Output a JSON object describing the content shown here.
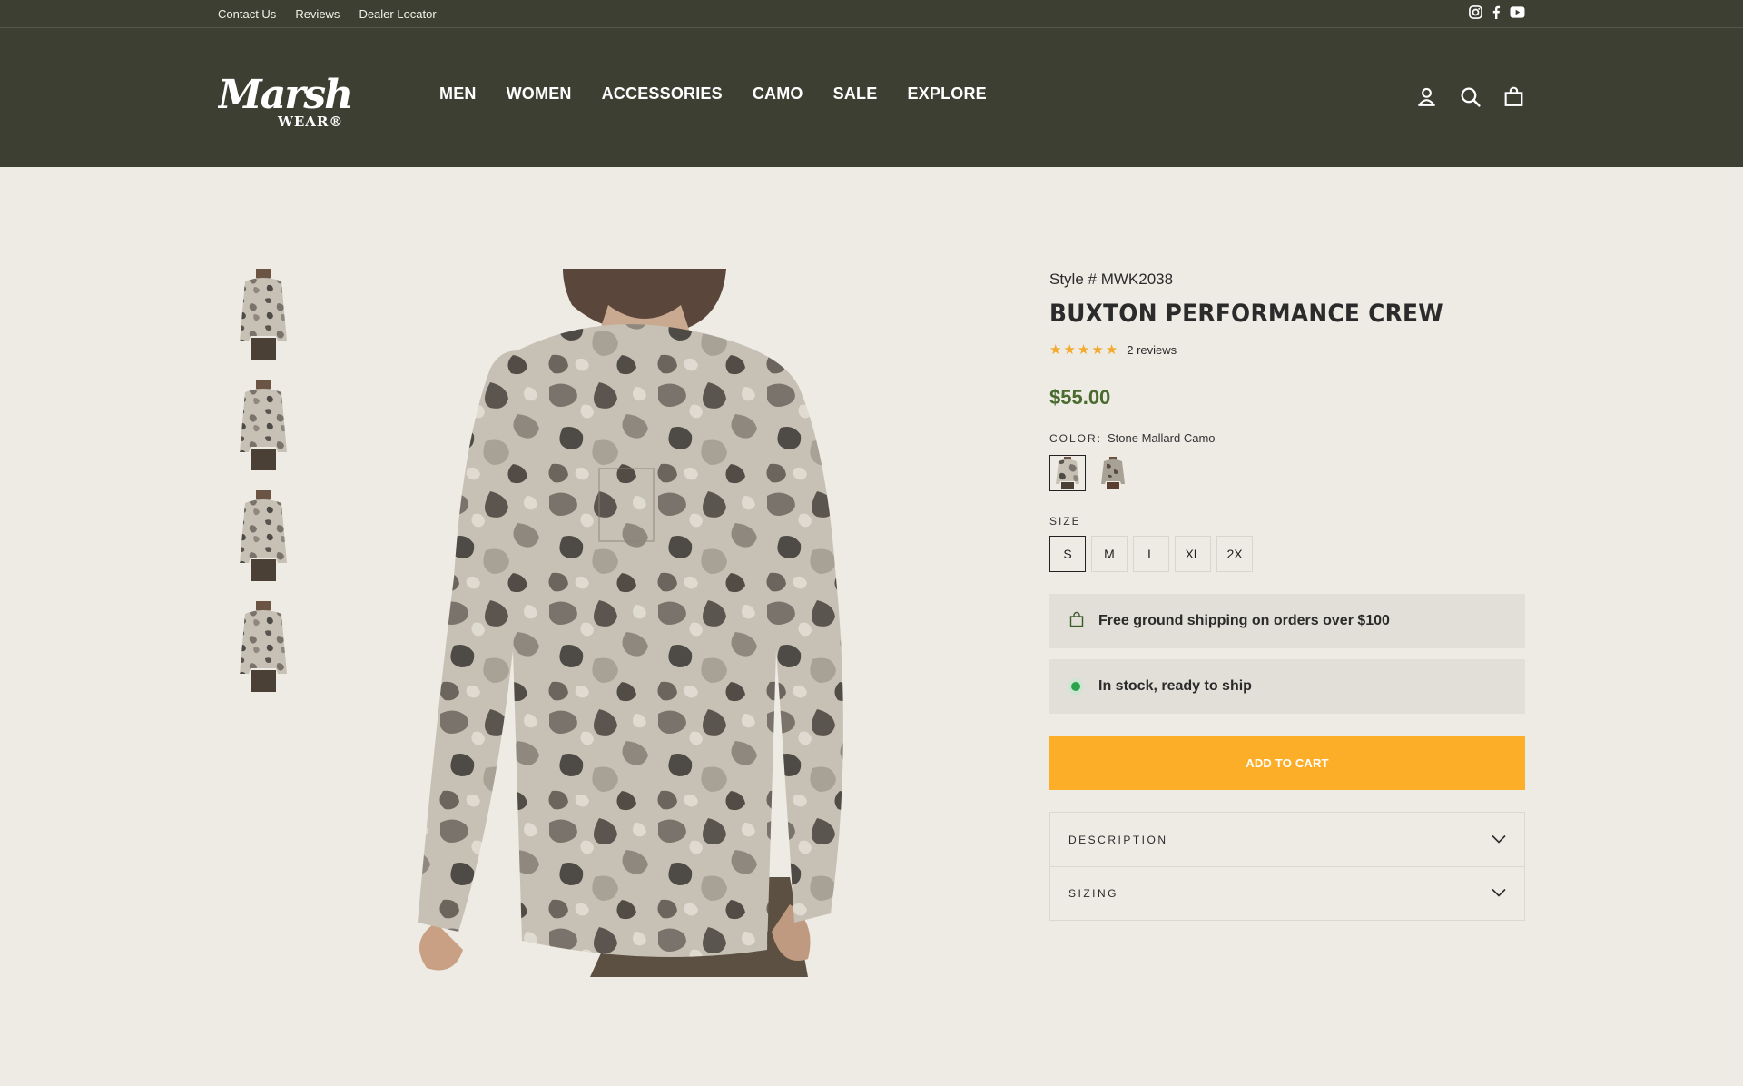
{
  "utility": {
    "links": [
      "Contact Us",
      "Reviews",
      "Dealer Locator"
    ],
    "social_icons": [
      "instagram-icon",
      "facebook-icon",
      "youtube-icon"
    ]
  },
  "header": {
    "logo_text": "Marsh WEAR",
    "nav": [
      "MEN",
      "WOMEN",
      "ACCESSORIES",
      "CAMO",
      "SALE",
      "EXPLORE"
    ],
    "icons": [
      "account-icon",
      "search-icon",
      "cart-icon"
    ]
  },
  "gallery": {
    "thumbnail_count": 4
  },
  "product": {
    "style_number": "Style # MWK2038",
    "title": "BUXTON PERFORMANCE CREW",
    "rating": 5,
    "reviews": "2 reviews",
    "price": "$55.00",
    "color_label": "COLOR:",
    "color_value": "Stone Mallard Camo",
    "size_label": "SIZE",
    "sizes": [
      "S",
      "M",
      "L",
      "XL",
      "2X"
    ],
    "selected_size": "S",
    "shipping_notice": "Free ground shipping on orders over $100",
    "stock_notice": "In stock, ready to ship",
    "add_to_cart": "ADD TO CART",
    "accordion": [
      "DESCRIPTION",
      "SIZING"
    ]
  },
  "colors": {
    "header_bg": "#3d3f33",
    "page_bg": "#edebe4",
    "price": "#4a6a2f",
    "cart_button": "#fcae29",
    "star": "#f3a929",
    "stock_dot": "#2aa34d"
  }
}
